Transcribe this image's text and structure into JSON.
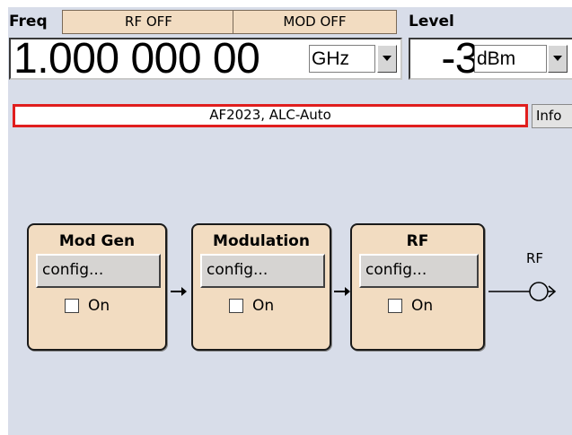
{
  "header": {
    "freq_label": "Freq",
    "level_label": "Level",
    "rf_state": "RF OFF",
    "mod_state": "MOD OFF"
  },
  "frequency": {
    "value": "1.000 000 00",
    "unit": "GHz"
  },
  "level": {
    "value": "-3",
    "unit": "dBm"
  },
  "status": {
    "text": "AF2023, ALC-Auto",
    "info_label": "Info"
  },
  "blocks": [
    {
      "title": "Mod Gen",
      "config_label": "config...",
      "on_label": "On",
      "on_checked": false
    },
    {
      "title": "Modulation",
      "config_label": "config...",
      "on_label": "On",
      "on_checked": false
    },
    {
      "title": "RF",
      "config_label": "config...",
      "on_label": "On",
      "on_checked": false
    }
  ],
  "output": {
    "label": "RF"
  },
  "colors": {
    "panel_bg": "#d8dde9",
    "block_bg": "#f2dcc1",
    "status_border": "#e01e1e"
  },
  "icons": [
    "dropdown-arrow-icon",
    "signal-arrow-icon",
    "rf-output-connector-icon"
  ]
}
